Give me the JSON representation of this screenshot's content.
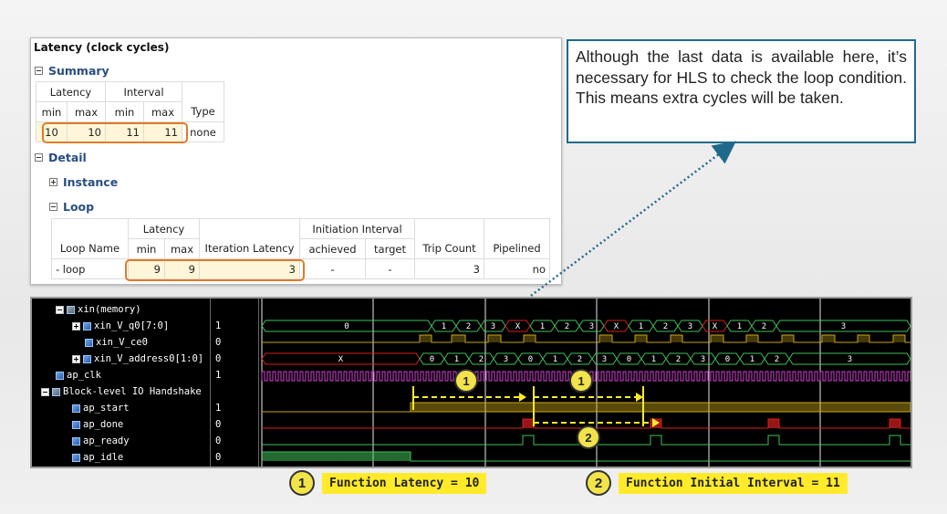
{
  "report": {
    "title": "Latency (clock cycles)",
    "summary_label": "Summary",
    "detail_label": "Detail",
    "instance_label": "Instance",
    "loop_label": "Loop",
    "summary_table": {
      "group_headers": [
        "Latency",
        "Interval"
      ],
      "sub_headers": [
        "min",
        "max",
        "min",
        "max",
        "Type"
      ],
      "row": [
        "10",
        "10",
        "11",
        "11",
        "none"
      ]
    },
    "loop_table": {
      "group_headers": [
        "Latency",
        "Initiation Interval"
      ],
      "sub_headers": [
        "Loop Name",
        "min",
        "max",
        "Iteration Latency",
        "achieved",
        "target",
        "Trip Count",
        "Pipelined"
      ],
      "row": [
        "- loop",
        "9",
        "9",
        "3",
        "-",
        "-",
        "3",
        "no"
      ]
    }
  },
  "callout": {
    "text": "Although the last data is available here, it’s necessary for HLS to check the loop condition. This means extra cycles will be taken."
  },
  "waveform": {
    "signals": [
      {
        "name": "xin(memory)",
        "value": ""
      },
      {
        "name": "xin_V_q0[7:0]",
        "value": "1"
      },
      {
        "name": "xin_V_ce0",
        "value": "0"
      },
      {
        "name": "xin_V_address0[1:0]",
        "value": "0"
      },
      {
        "name": "ap_clk",
        "value": "1"
      },
      {
        "name": "Block-level IO Handshake",
        "value": ""
      },
      {
        "name": "ap_start",
        "value": "1"
      },
      {
        "name": "ap_done",
        "value": "0"
      },
      {
        "name": "ap_ready",
        "value": "0"
      },
      {
        "name": "ap_idle",
        "value": "0"
      }
    ],
    "q0_values": [
      "0",
      "1",
      "2",
      "3",
      "X",
      "1",
      "2",
      "3",
      "X",
      "1",
      "2",
      "3",
      "X",
      "1",
      "2",
      "3"
    ],
    "addr_values": [
      "X",
      "0",
      "1",
      "2",
      "3",
      "0",
      "1",
      "2",
      "3",
      "0",
      "1",
      "2",
      "3",
      "0",
      "1",
      "2",
      "3"
    ],
    "marker_1": "1",
    "marker_2": "2"
  },
  "legend": [
    {
      "num": "1",
      "text": "Function Latency = 10"
    },
    {
      "num": "2",
      "text": "Function Initial Interval = 11"
    }
  ],
  "colors": {
    "highlight_border": "#e07b28",
    "callout_border": "#1f6a8c",
    "bus_green": "#3fbf5a",
    "clock_magenta": "#d640d6",
    "signal_yellow": "#c8a416",
    "done_red": "#d82020",
    "label_yellow": "#ffeb2a"
  }
}
